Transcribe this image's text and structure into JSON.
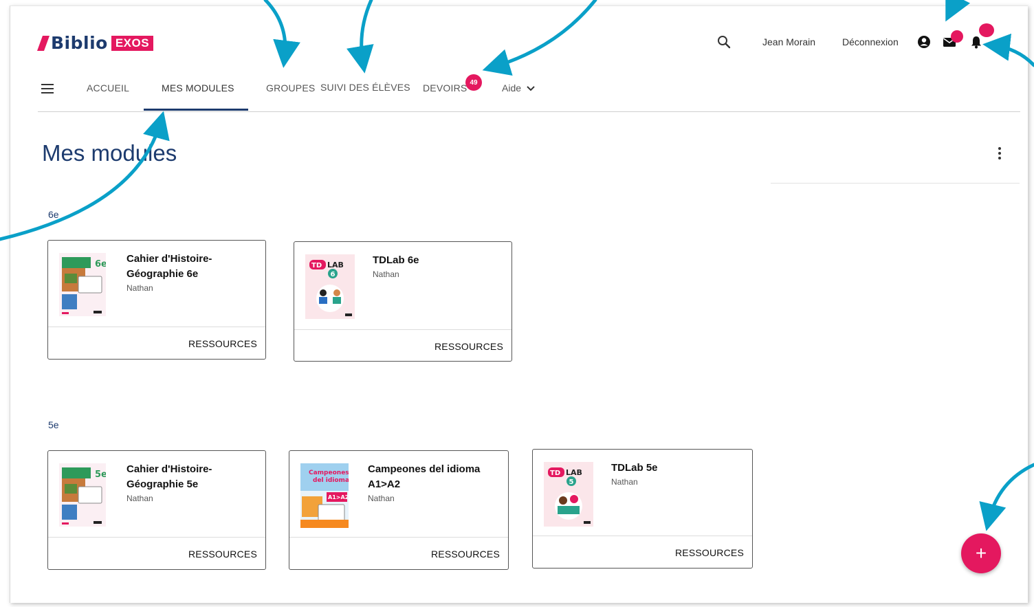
{
  "brand": {
    "name": "Biblio",
    "tag": "EXOS"
  },
  "header": {
    "user_name": "Jean Morain",
    "logout_label": "Déconnexion"
  },
  "nav": {
    "tabs": [
      "ACCUEIL",
      "MES MODULES",
      "GROUPES",
      "SUIVI DES ÉLÈVES",
      "DEVOIRS"
    ],
    "active_tab": "MES MODULES",
    "devoirs_badge": "49",
    "help_label": "Aide"
  },
  "page": {
    "title": "Mes modules"
  },
  "sections": [
    {
      "level": "6e",
      "modules": [
        {
          "title": "Cahier d'Histoire-Géographie 6e",
          "publisher": "Nathan",
          "action": "RESSOURCES",
          "grade_mark": "6e"
        },
        {
          "title": "TDLab 6e",
          "publisher": "Nathan",
          "action": "RESSOURCES",
          "grade_mark": "6"
        }
      ]
    },
    {
      "level": "5e",
      "modules": [
        {
          "title": "Cahier d'Histoire-Géographie 5e",
          "publisher": "Nathan",
          "action": "RESSOURCES",
          "grade_mark": "5e"
        },
        {
          "title": "Campeones del idioma A1>A2",
          "publisher": "Nathan",
          "action": "RESSOURCES",
          "grade_mark": "A1>A2"
        },
        {
          "title": "TDLab 5e",
          "publisher": "Nathan",
          "action": "RESSOURCES",
          "grade_mark": "5"
        }
      ]
    }
  ],
  "fab": {
    "label": "+"
  },
  "colors": {
    "accent": "#e4185f",
    "primary": "#1d3b6e",
    "annotation": "#0aa0c8"
  },
  "icons": [
    "search-icon",
    "account-icon",
    "mail-icon",
    "bell-icon",
    "menu-icon",
    "chevron-down-icon",
    "more-vertical-icon",
    "plus-icon"
  ]
}
